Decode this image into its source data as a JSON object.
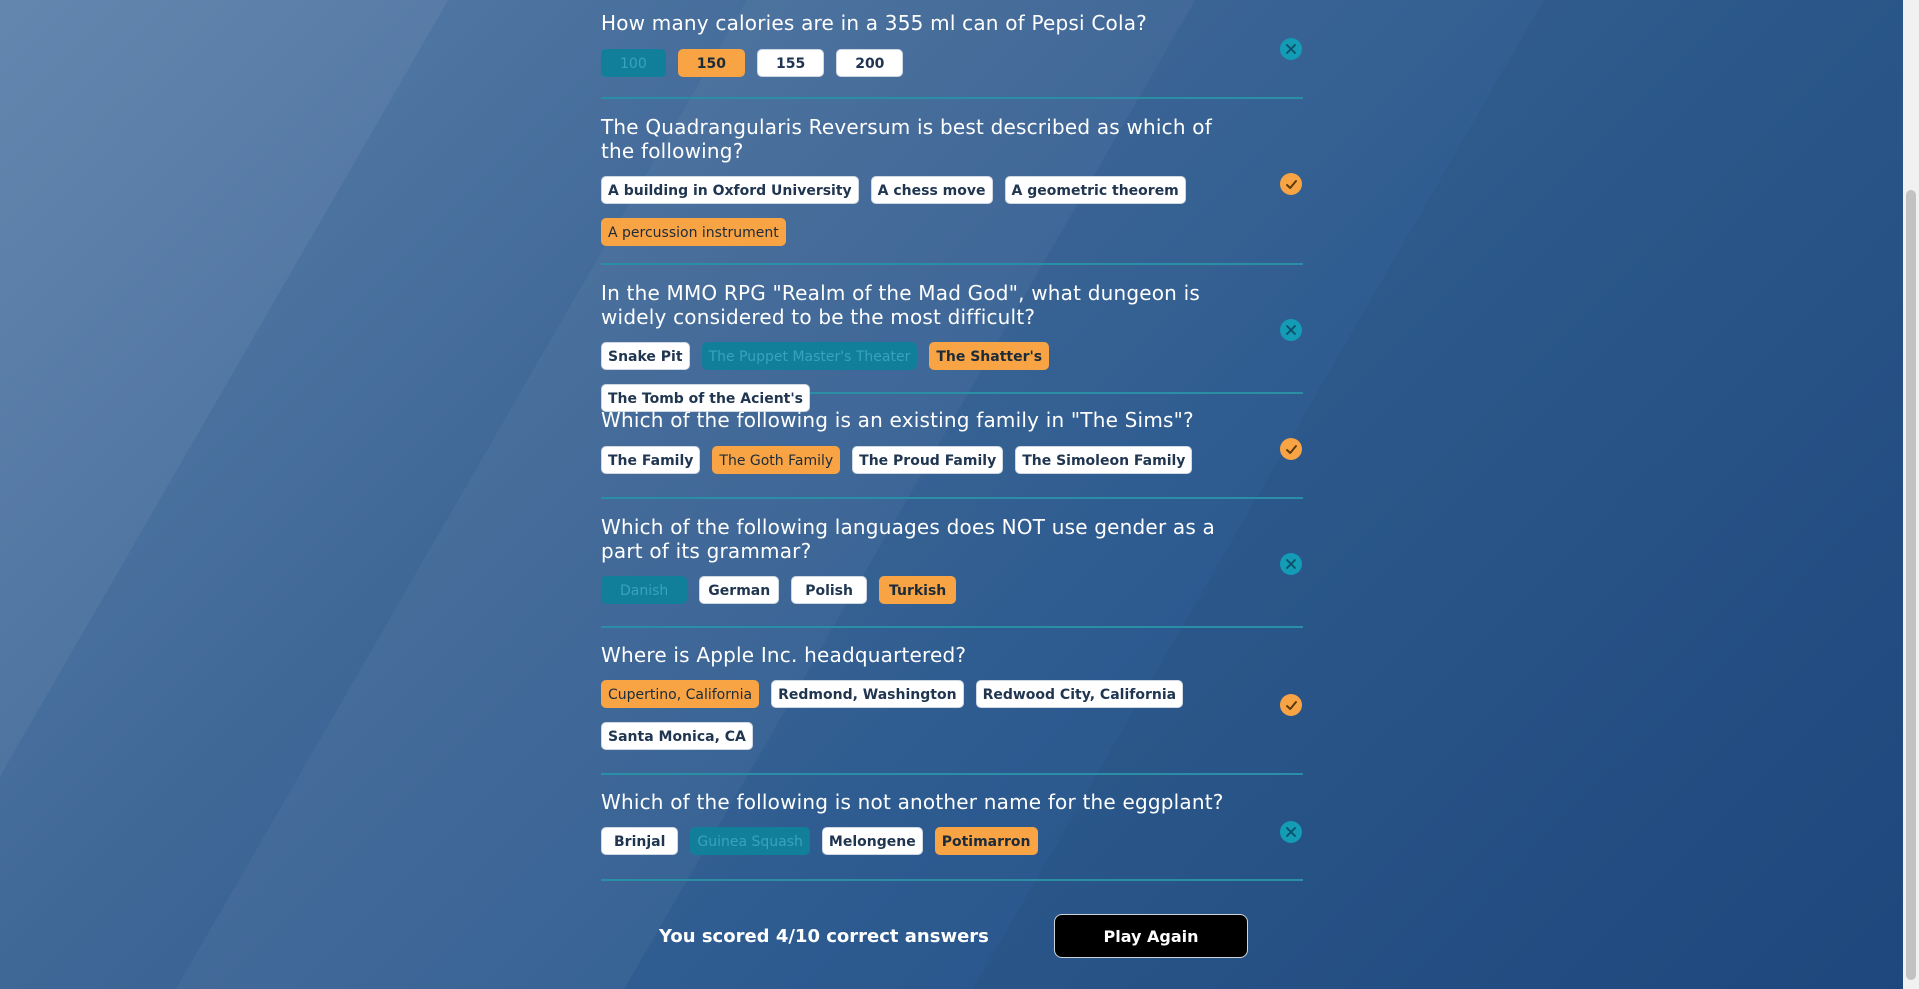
{
  "questions": [
    {
      "text": "How many calories are in a 355 ml can of Pepsi Cola?",
      "result": "wrong",
      "answers": [
        {
          "label": "100",
          "state": "correct-answer"
        },
        {
          "label": "150",
          "state": "selected"
        },
        {
          "label": "155",
          "state": "normal"
        },
        {
          "label": "200",
          "state": "normal"
        }
      ]
    },
    {
      "text": "The Quadrangularis Reversum is best described as which of the following?",
      "result": "correct",
      "answers": [
        {
          "label": "A building in Oxford University",
          "state": "normal"
        },
        {
          "label": "A chess move",
          "state": "normal"
        },
        {
          "label": "A geometric theorem",
          "state": "normal"
        },
        {
          "label": "A percussion instrument",
          "state": "selected"
        }
      ]
    },
    {
      "text": "In the MMO RPG \"Realm of the Mad God\", what dungeon is widely considered to be the most difficult?",
      "result": "wrong",
      "answers": [
        {
          "label": "Snake Pit",
          "state": "normal"
        },
        {
          "label": "The Puppet Master's Theater",
          "state": "correct-answer"
        },
        {
          "label": "The Shatter's",
          "state": "selected"
        },
        {
          "label": "The Tomb of the Acient's",
          "state": "normal"
        }
      ]
    },
    {
      "text": "Which of the following is an existing family in \"The Sims\"?",
      "result": "correct",
      "answers": [
        {
          "label": "The Family",
          "state": "normal"
        },
        {
          "label": "The Goth Family",
          "state": "selected"
        },
        {
          "label": "The Proud Family",
          "state": "normal"
        },
        {
          "label": "The Simoleon Family",
          "state": "normal"
        }
      ]
    },
    {
      "text": "Which of the following languages does NOT use gender as a part of its grammar?",
      "result": "wrong",
      "answers": [
        {
          "label": "Danish",
          "state": "correct-answer"
        },
        {
          "label": "German",
          "state": "normal"
        },
        {
          "label": "Polish",
          "state": "normal"
        },
        {
          "label": "Turkish",
          "state": "selected"
        }
      ]
    },
    {
      "text": "Where is Apple Inc. headquartered?",
      "result": "correct",
      "answers": [
        {
          "label": "Cupertino, California",
          "state": "selected"
        },
        {
          "label": "Redmond, Washington",
          "state": "normal"
        },
        {
          "label": "Redwood City, California",
          "state": "normal"
        },
        {
          "label": "Santa Monica, CA",
          "state": "normal"
        }
      ]
    },
    {
      "text": "Which of the following is not another name for the eggplant?",
      "result": "wrong",
      "answers": [
        {
          "label": "Brinjal",
          "state": "normal"
        },
        {
          "label": "Guinea Squash",
          "state": "correct-answer"
        },
        {
          "label": "Melongene",
          "state": "normal"
        },
        {
          "label": "Potimarron",
          "state": "selected"
        }
      ]
    }
  ],
  "footer": {
    "score_text": "You scored 4/10 correct answers",
    "play_again_label": "Play Again"
  },
  "colors": {
    "selected": "#f8a444",
    "correct_answer": "#127f9a",
    "divider": "#2a8fa6",
    "button_bg": "#000000"
  },
  "icons": {
    "correct": "check-icon",
    "wrong": "close-icon"
  }
}
